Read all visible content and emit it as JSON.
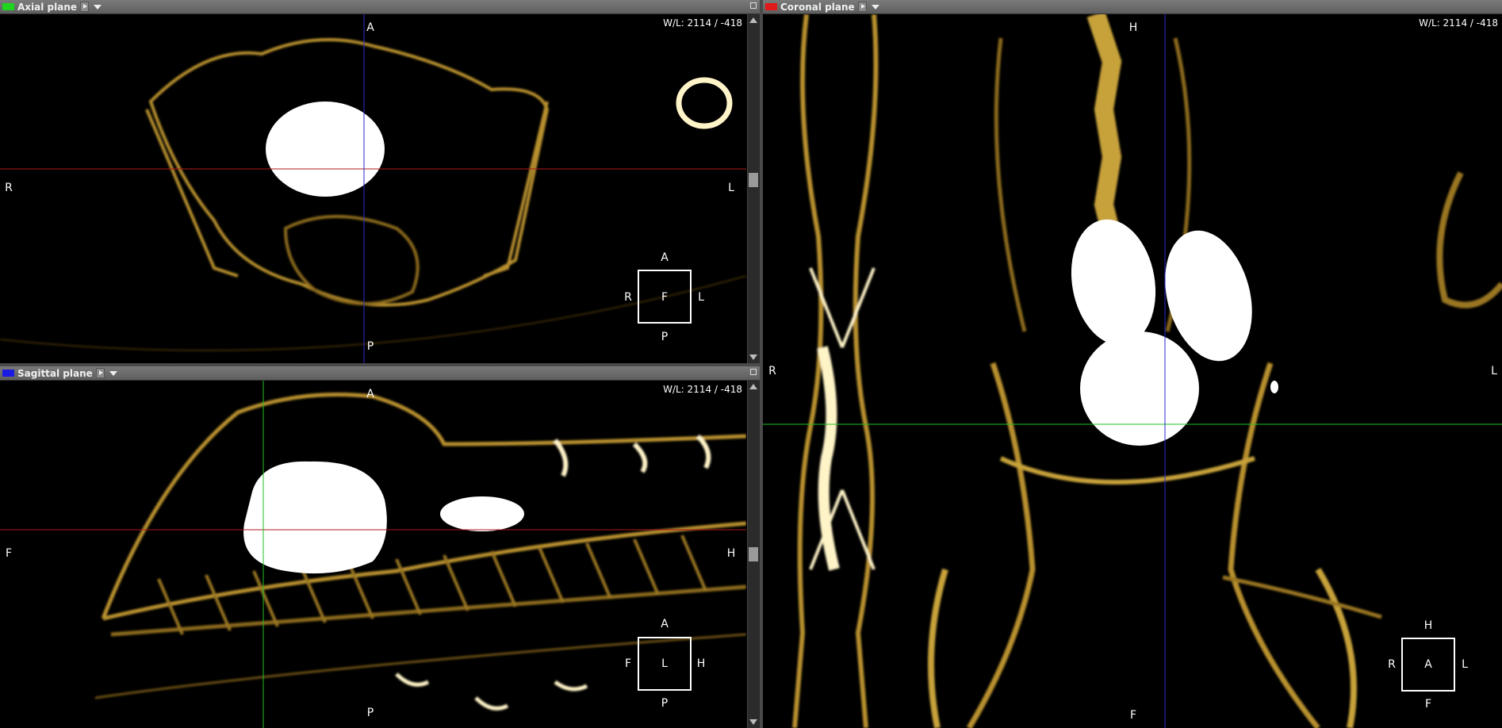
{
  "axial": {
    "title": "Axial plane",
    "swatch_color": "#1fd41f",
    "wl": "W/L: 2114 / -418",
    "labels": {
      "top": "A",
      "bottom": "P",
      "left": "R",
      "right": "L"
    },
    "cube": {
      "top": "A",
      "bottom": "P",
      "left": "R",
      "right": "L",
      "center": "F"
    }
  },
  "sagittal": {
    "title": "Sagittal plane",
    "swatch_color": "#1a1ae0",
    "wl": "W/L: 2114 / -418",
    "labels": {
      "top": "A",
      "bottom": "P",
      "left": "F",
      "right": "H"
    },
    "cube": {
      "top": "A",
      "bottom": "P",
      "left": "F",
      "right": "H",
      "center": "L"
    }
  },
  "coronal": {
    "title": "Coronal plane",
    "swatch_color": "#e01a1a",
    "wl": "W/L: 2114 / -418",
    "labels": {
      "top": "H",
      "bottom": "F",
      "left": "R",
      "right": "L"
    },
    "cube": {
      "top": "H",
      "bottom": "F",
      "left": "R",
      "right": "L",
      "center": "A"
    }
  },
  "colors": {
    "bone": "#c7a23a",
    "bone_bright": "#fff4c8",
    "crosshair_red": "#b01818",
    "crosshair_blue": "#2a2ad0",
    "crosshair_green": "#22c022"
  }
}
